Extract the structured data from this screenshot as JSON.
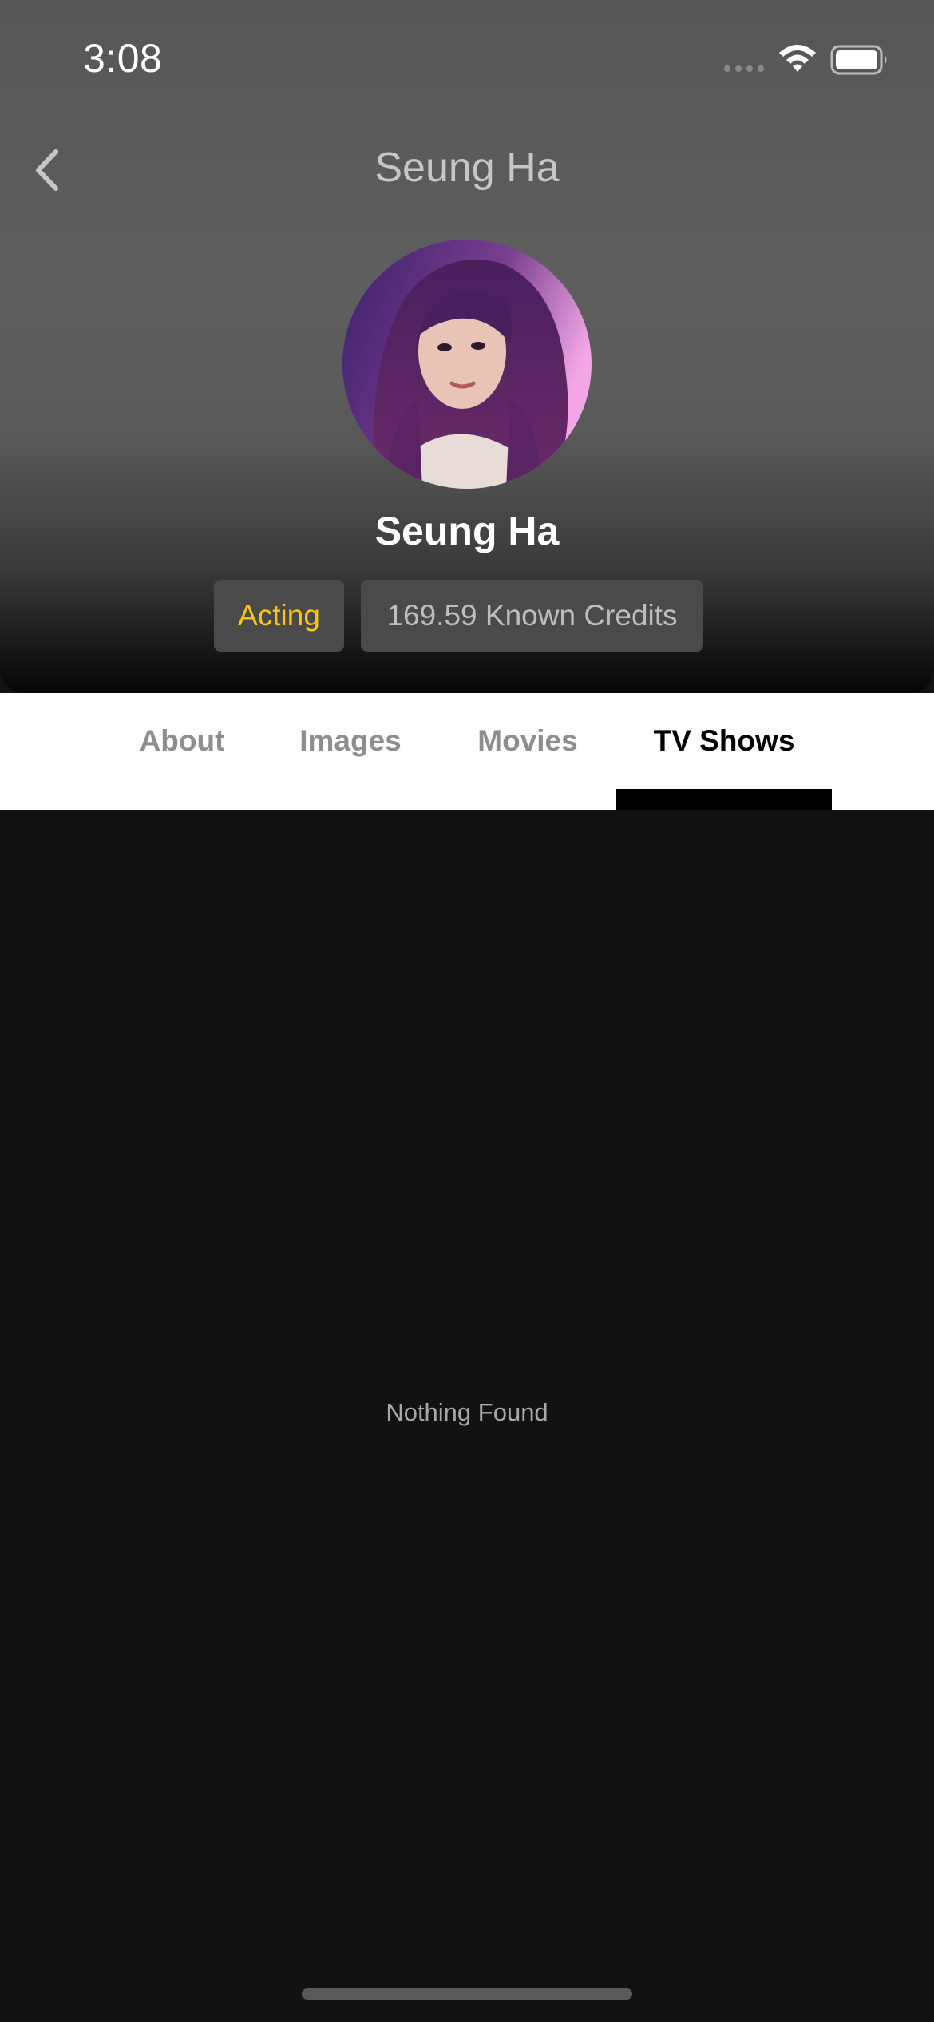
{
  "status_bar": {
    "time": "3:08",
    "icons": [
      "signal-dots-icon",
      "wifi-icon",
      "battery-icon"
    ]
  },
  "nav": {
    "back_icon": "chevron-left-icon",
    "title": "Seung Ha"
  },
  "profile": {
    "name": "Seung Ha",
    "department": "Acting",
    "credits": "169.59 Known Credits"
  },
  "tabs": [
    {
      "label": "About",
      "active": false
    },
    {
      "label": "Images",
      "active": false
    },
    {
      "label": "Movies",
      "active": false
    },
    {
      "label": "TV Shows",
      "active": true
    }
  ],
  "content": {
    "empty_message": "Nothing Found"
  },
  "colors": {
    "accent": "#f5c518",
    "background": "#121212",
    "tab_active": "#000000",
    "tab_inactive": "#8e8e8e"
  }
}
